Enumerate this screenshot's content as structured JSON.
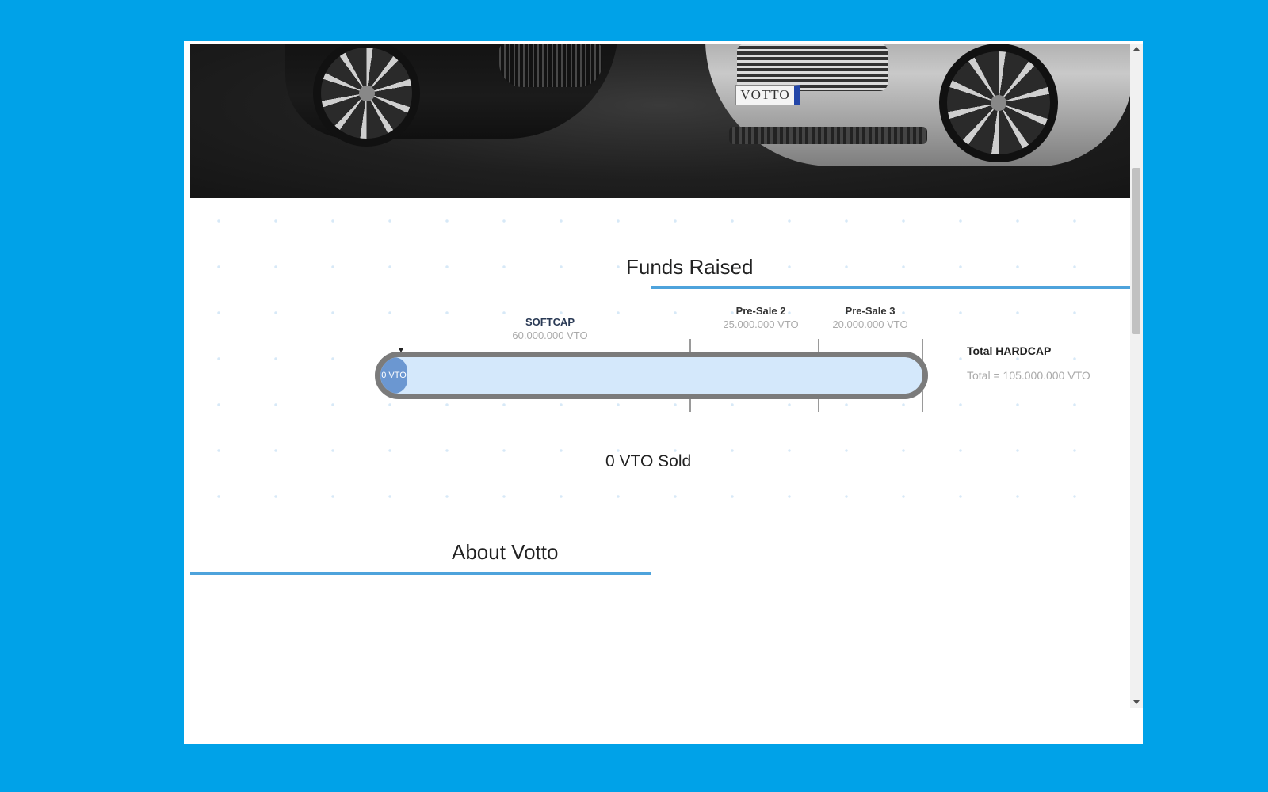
{
  "hero": {
    "plate_text": "VOTTO"
  },
  "funds": {
    "title": "Funds Raised",
    "softcap": {
      "label": "SOFTCAP",
      "amount": "60.000.000 VTO"
    },
    "presale2": {
      "label": "Pre-Sale 2",
      "amount": "25.000.000 VTO"
    },
    "presale3": {
      "label": "Pre-Sale 3",
      "amount": "20.000.000 VTO"
    },
    "progress": {
      "label": "0 VTO",
      "fraction": 0.0
    },
    "hardcap": {
      "title": "Total HARDCAP",
      "total": "Total = 105.000.000 VTO"
    },
    "sold_text": "0 VTO Sold"
  },
  "about": {
    "title": "About Votto"
  },
  "colors": {
    "page_background": "#00a2e8",
    "accent_line": "#4ea3dc",
    "progress_track": "#d4e8fb",
    "progress_fill": "#6b97d1",
    "progress_border": "#7b7b7b"
  }
}
